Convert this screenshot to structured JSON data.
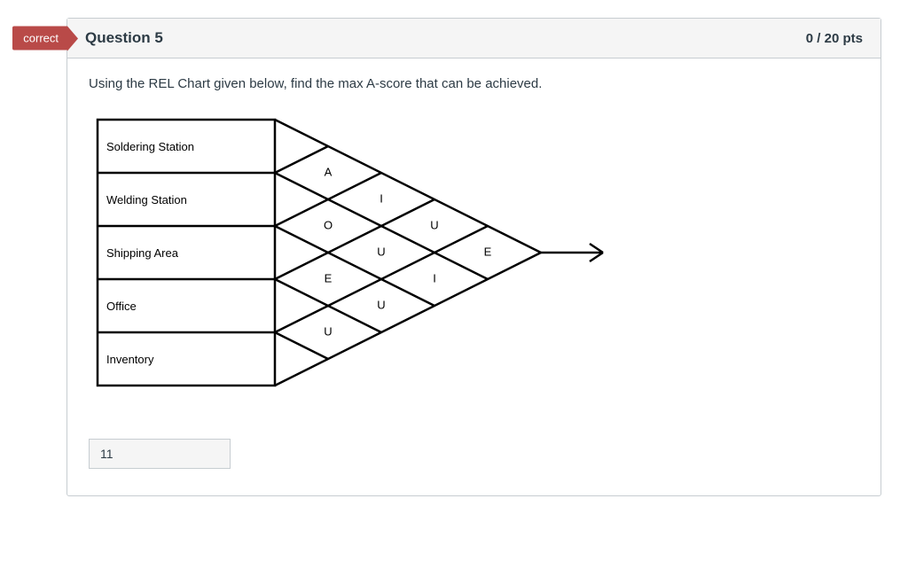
{
  "header": {
    "incorrect_tag": "correct",
    "title": "Question 5",
    "points": "0 / 20 pts"
  },
  "prompt": "Using the REL Chart given below, find the max A-score that can be achieved.",
  "chart_data": {
    "type": "table",
    "title": "REL Chart",
    "departments": [
      "Soldering Station",
      "Welding Station",
      "Shipping Area",
      "Office",
      "Inventory"
    ],
    "relationships": {
      "col1": [
        "A",
        "O",
        "E",
        "U"
      ],
      "col2": [
        "I",
        "U",
        "U"
      ],
      "col3": [
        "U",
        "I"
      ],
      "col4": [
        "E"
      ]
    }
  },
  "answer": "11"
}
